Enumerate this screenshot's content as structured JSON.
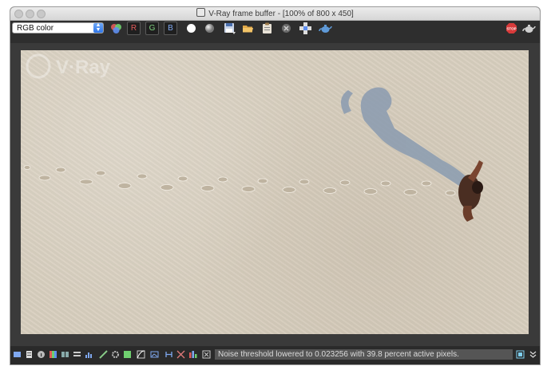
{
  "window": {
    "title": "V-Ray frame buffer - [100% of 800 x 450]"
  },
  "toolbar": {
    "color_channel": {
      "selected": "RGB color"
    },
    "channels": [
      {
        "label": "R",
        "color": "#e05a5a"
      },
      {
        "label": "G",
        "color": "#7fd27f"
      },
      {
        "label": "B",
        "color": "#7fa8f0"
      }
    ]
  },
  "render": {
    "watermark": "V·Ray"
  },
  "status": {
    "message": "Noise threshold lowered to 0.023256 with 39.8 percent active pixels."
  },
  "colors": {
    "toolbar_bg": "#2e2e2e",
    "sand": "#d8cfbf",
    "stop_red": "#d83a3a"
  }
}
